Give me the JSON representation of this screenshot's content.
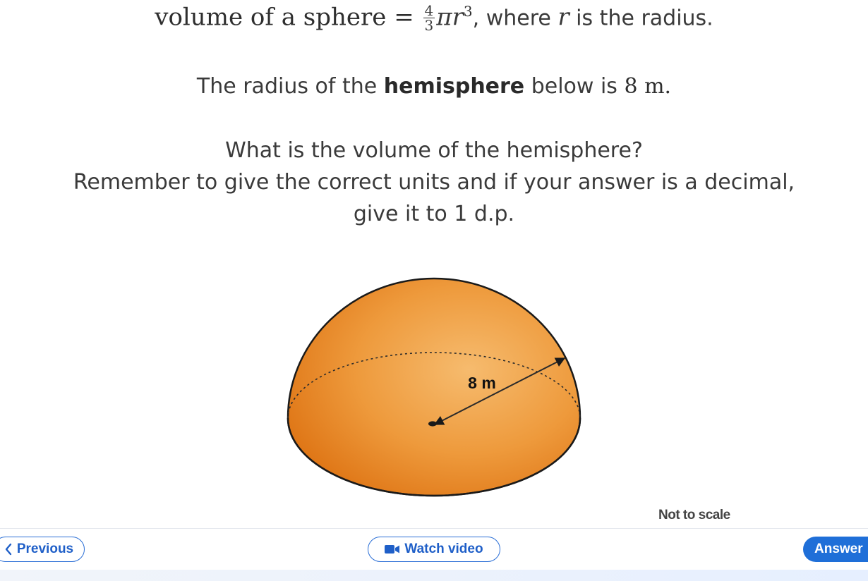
{
  "question": {
    "formula": {
      "lhs": "volume of a sphere = ",
      "frac_num": "4",
      "frac_den": "3",
      "pi": "π",
      "r": "r",
      "power": "3",
      "tail_text": ", where ",
      "r2": "r",
      "tail_end": " is the radius."
    },
    "line1": {
      "pre": "The radius of the ",
      "bold": "hemisphere",
      "post": " below is ",
      "value": "8 m."
    },
    "line2": "What is the volume of the hemisphere?",
    "line3": "Remember to give the correct units and if your answer is a decimal,",
    "line4": "give it to 1 d.p."
  },
  "figure": {
    "radius_label": "8 m",
    "note": "Not to scale",
    "colors": {
      "fill": "#e8821e",
      "fill_light": "#f5b565",
      "outline": "#1a1a1a"
    }
  },
  "nav": {
    "previous_label": "Previous",
    "watch_label": "Watch video",
    "answer_label": "Answer"
  },
  "colors": {
    "accent": "#1f6fd8",
    "text": "#3a3a3a"
  }
}
